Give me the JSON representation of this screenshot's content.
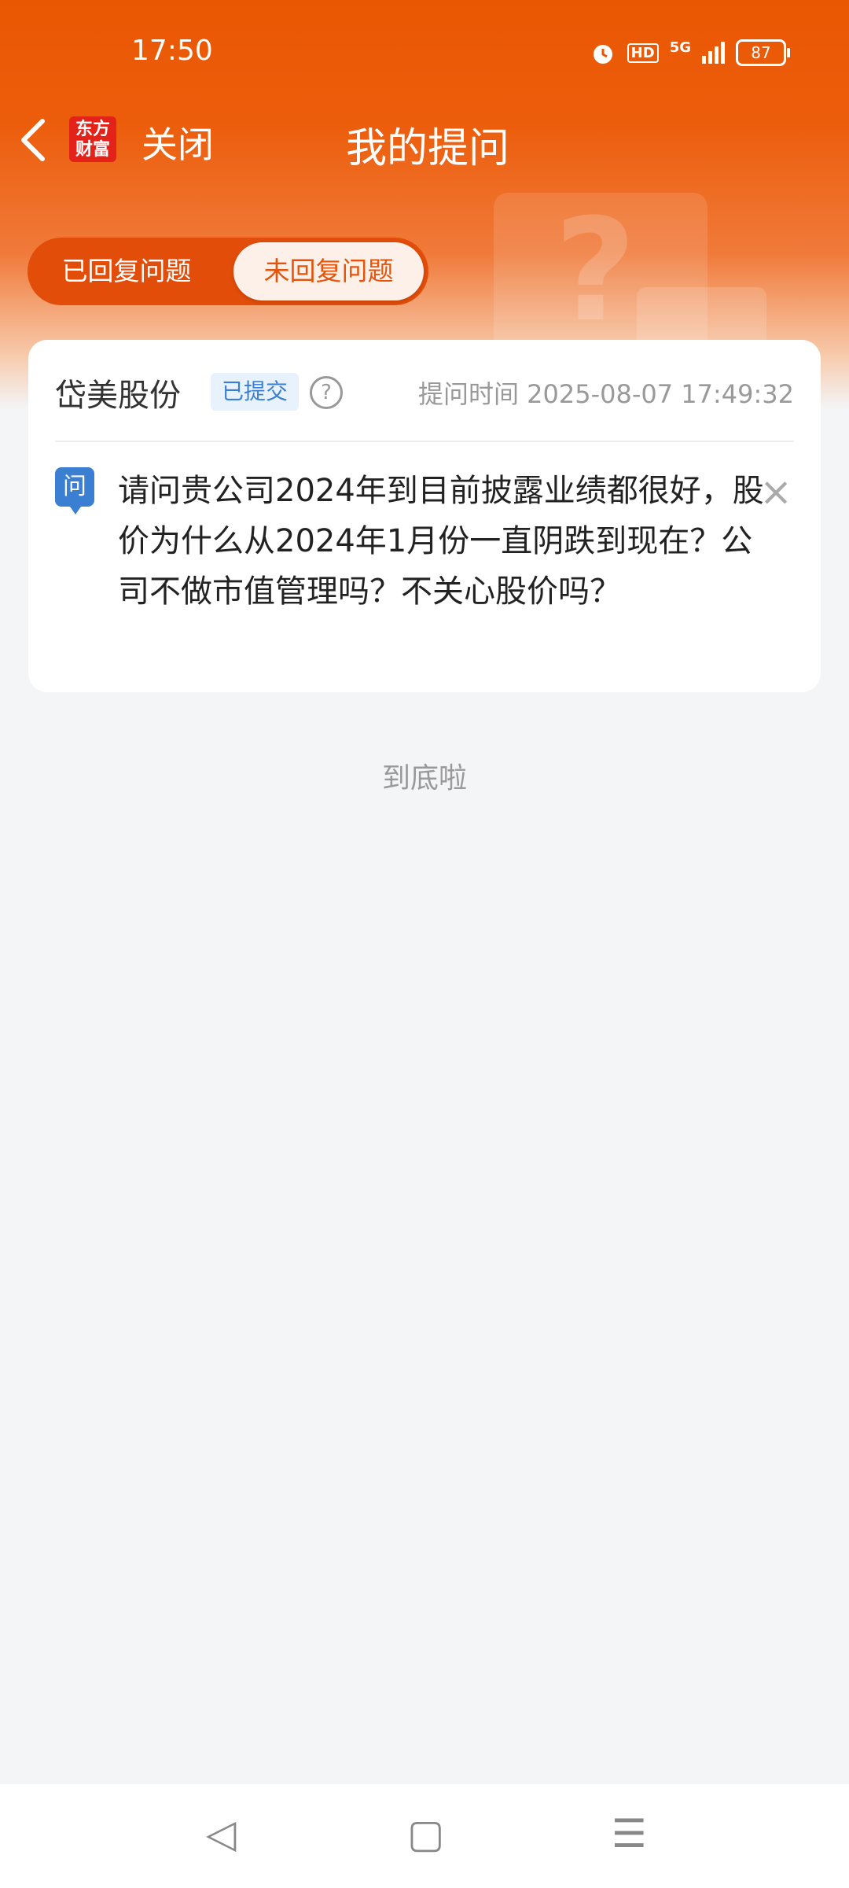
{
  "status_bar": {
    "time": "17:50",
    "hd": "HD",
    "network": "5G",
    "battery": "87"
  },
  "nav": {
    "back_icon": "chevron-left-icon",
    "logo_text": "东方财富",
    "close_label": "关闭",
    "title": "我的提问"
  },
  "tabs": [
    {
      "label": "已回复问题",
      "selected": false
    },
    {
      "label": "未回复问题",
      "selected": true
    }
  ],
  "question_card": {
    "company": "岱美股份",
    "status_badge": "已提交",
    "help_icon": "?",
    "time_label": "提问时间 2025-08-07 17:49:32",
    "question_icon": "问",
    "question_text": "请问贵公司2024年到目前披露业绩都很好，股价为什么从2024年1月份一直阴跌到现在？公司不做市值管理吗？不关心股价吗？",
    "close_icon": "×"
  },
  "list_end_text": "到底啦",
  "system_nav": {
    "back": "◁",
    "home": "▢",
    "menu": "☰"
  },
  "colors": {
    "brand_orange": "#ea5703",
    "accent_blue": "#3b7fd3",
    "background": "#f4f5f7"
  }
}
